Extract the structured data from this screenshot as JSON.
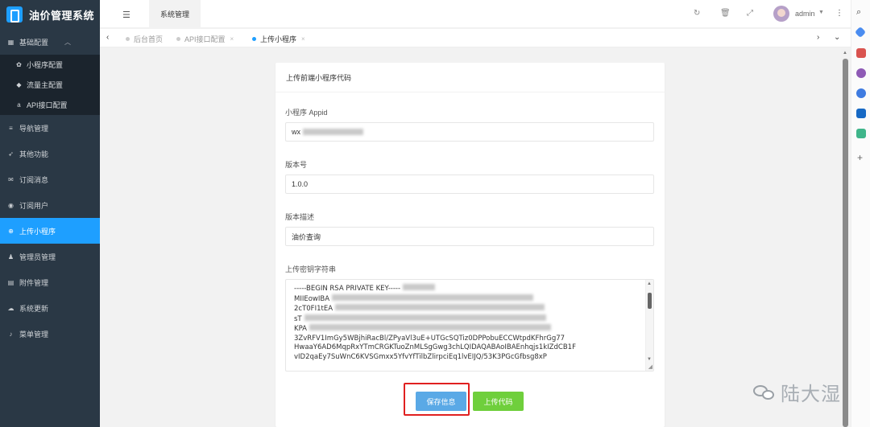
{
  "app": {
    "title": "油价管理系统"
  },
  "sidebar": {
    "items": [
      {
        "label": "基础配置",
        "icon": "grid-icon",
        "open": true,
        "children": [
          {
            "label": "小程序配置",
            "icon": "gear-icon"
          },
          {
            "label": "流量主配置",
            "icon": "ad-icon"
          },
          {
            "label": "API接口配置",
            "icon": "amazon-icon"
          }
        ]
      },
      {
        "label": "导航管理",
        "icon": "list-icon"
      },
      {
        "label": "其他功能",
        "icon": "rocket-icon"
      },
      {
        "label": "订阅消息",
        "icon": "mail-icon"
      },
      {
        "label": "订阅用户",
        "icon": "user-circle-icon"
      },
      {
        "label": "上传小程序",
        "icon": "plus-circle-icon",
        "active": true
      },
      {
        "label": "管理员管理",
        "icon": "user-icon"
      },
      {
        "label": "附件管理",
        "icon": "file-icon"
      },
      {
        "label": "系统更新",
        "icon": "cloud-icon"
      },
      {
        "label": "菜单管理",
        "icon": "bell-icon"
      }
    ]
  },
  "header": {
    "top_tab": "系统管理",
    "user": "admin"
  },
  "tabs": [
    {
      "label": "后台首页",
      "closable": false,
      "current": false
    },
    {
      "label": "API接口配置",
      "closable": true,
      "current": false
    },
    {
      "label": "上传小程序",
      "closable": true,
      "current": true
    }
  ],
  "form": {
    "title": "上传前端小程序代码",
    "appid_label": "小程序 Appid",
    "appid_value": "wx",
    "version_label": "版本号",
    "version_value": "1.0.0",
    "desc_label": "版本描述",
    "desc_value": "油价查询",
    "key_label": "上传密钥字符串",
    "key_lines": [
      "-----BEGIN RSA PRIVATE KEY-----",
      "MIIEowIBA",
      "2cT0FI1tEA",
      "sT",
      "KPA",
      "3ZvRFV1ImGy5WBjhiRacBl/ZPyaVl3uE+UTGcSQTiz0DPPobuECCWtpdKFhrGg77",
      "HwaaY6AD6MqpRxYTmCRGKTuoZnMLSgGwg3chLQIDAQABAoIBAEnhqjs1kIZdCB1F",
      "vID2qaEy7SuWnC6KVSGmxx5YfvYfTilbZlirpciEq1lvEIJQ/53K3PGcGfbsg8xP"
    ],
    "save_button": "保存信息",
    "upload_button": "上传代码"
  },
  "colors": {
    "sidebar_bg": "#2a3845",
    "accent": "#1e9fff",
    "save_btn": "#5aa9e6",
    "upload_btn": "#6fcf3c",
    "highlight": "#e02020"
  },
  "watermark": {
    "text": "陆大湿"
  }
}
